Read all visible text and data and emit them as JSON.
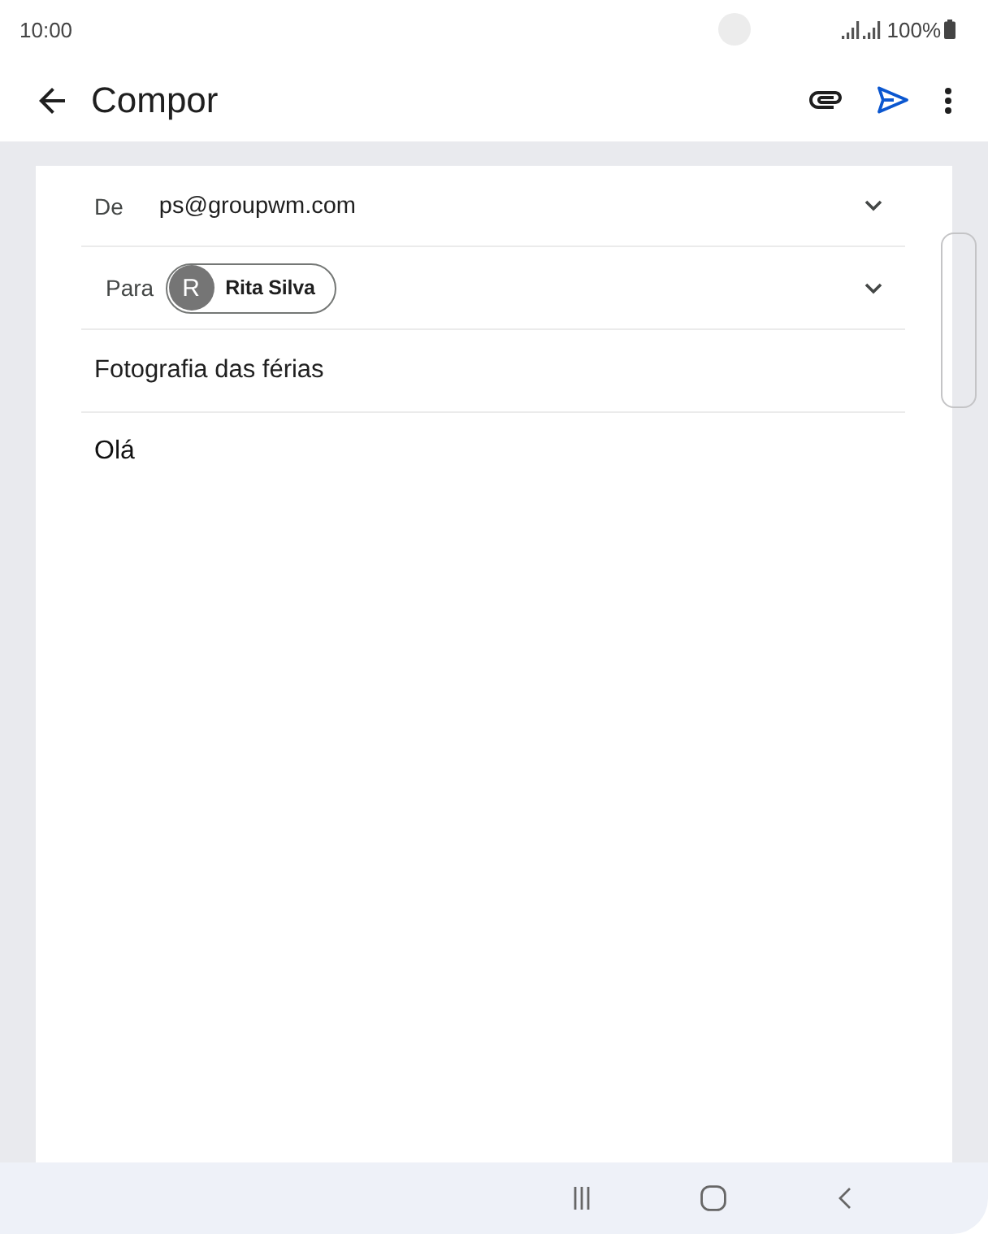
{
  "status_bar": {
    "time": "10:00",
    "battery": "100%"
  },
  "app_bar": {
    "title": "Compor"
  },
  "compose": {
    "from": {
      "label": "De",
      "value": "ps@groupwm.com"
    },
    "to": {
      "label": "Para",
      "recipients": [
        {
          "initial": "R",
          "name": "Rita Silva"
        }
      ]
    },
    "subject": "Fotografia das férias",
    "body": "Olá"
  }
}
